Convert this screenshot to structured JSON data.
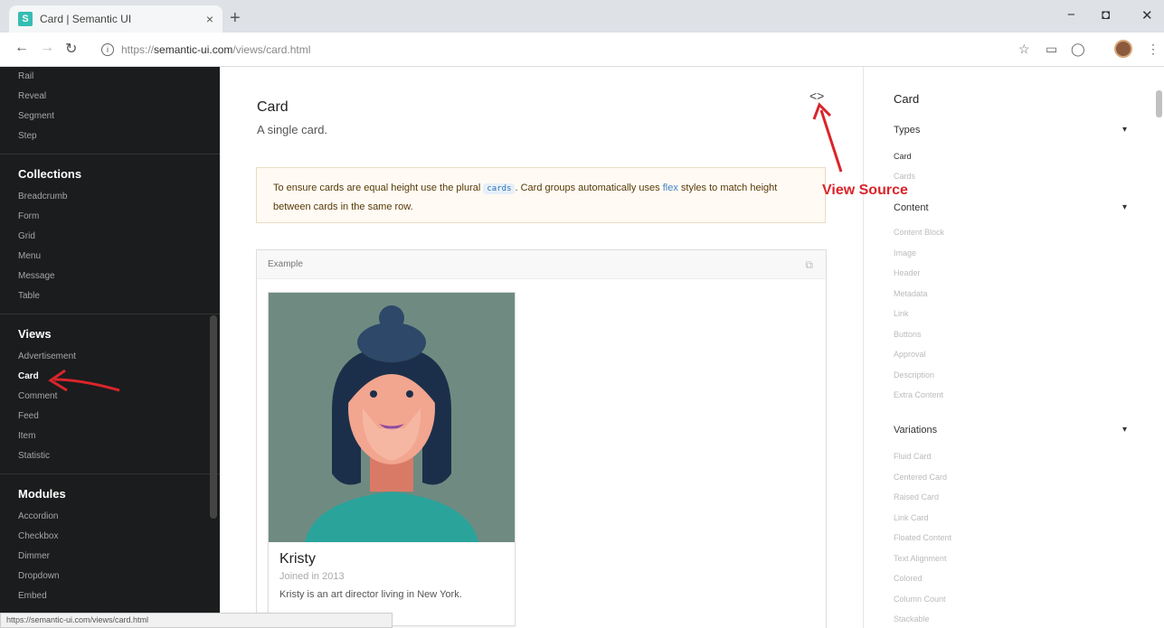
{
  "browser": {
    "tab_title": "Card | Semantic UI",
    "favicon_letter": "S",
    "tab_close": "×",
    "new_tab": "+",
    "url_prefix": "https://",
    "url_host": "semantic-ui.com",
    "url_path": "/views/card.html",
    "status_url": "https://semantic-ui.com/views/card.html",
    "minimize": "−",
    "restore": "◘",
    "close": "✕"
  },
  "sidebar": {
    "top_items": [
      "Rail",
      "Reveal",
      "Segment",
      "Step"
    ],
    "collections_header": "Collections",
    "collections": [
      "Breadcrumb",
      "Form",
      "Grid",
      "Menu",
      "Message",
      "Table"
    ],
    "views_header": "Views",
    "views": [
      "Advertisement",
      "Card",
      "Comment",
      "Feed",
      "Item",
      "Statistic"
    ],
    "modules_header": "Modules",
    "modules": [
      "Accordion",
      "Checkbox",
      "Dimmer",
      "Dropdown",
      "Embed"
    ]
  },
  "content": {
    "title": "Card",
    "subtitle": "A single card.",
    "view_source_icon": "<>",
    "note_before": "To ensure cards are equal height use the plural",
    "note_code": "cards",
    "note_mid": ". Card groups automatically uses",
    "note_link": "flex",
    "note_after": "styles to match height between cards in the same row.",
    "example_label": "Example",
    "card": {
      "name": "Kristy",
      "meta": "Joined in 2013",
      "description": "Kristy is an art director living in New York."
    }
  },
  "rightnav": {
    "title": "Card",
    "types": {
      "label": "Types",
      "items": [
        "Card",
        "Cards"
      ]
    },
    "content": {
      "label": "Content",
      "items": [
        "Content Block",
        "Image",
        "Header",
        "Metadata",
        "Link",
        "Buttons",
        "Approval",
        "Description",
        "Extra Content"
      ]
    },
    "variations": {
      "label": "Variations",
      "items": [
        "Fluid Card",
        "Centered Card",
        "Raised Card",
        "Link Card",
        "Floated Content",
        "Text Alignment",
        "Colored",
        "Column Count",
        "Stackable"
      ]
    }
  },
  "annotation": {
    "text": "View Source",
    "color": "#d9252b"
  }
}
